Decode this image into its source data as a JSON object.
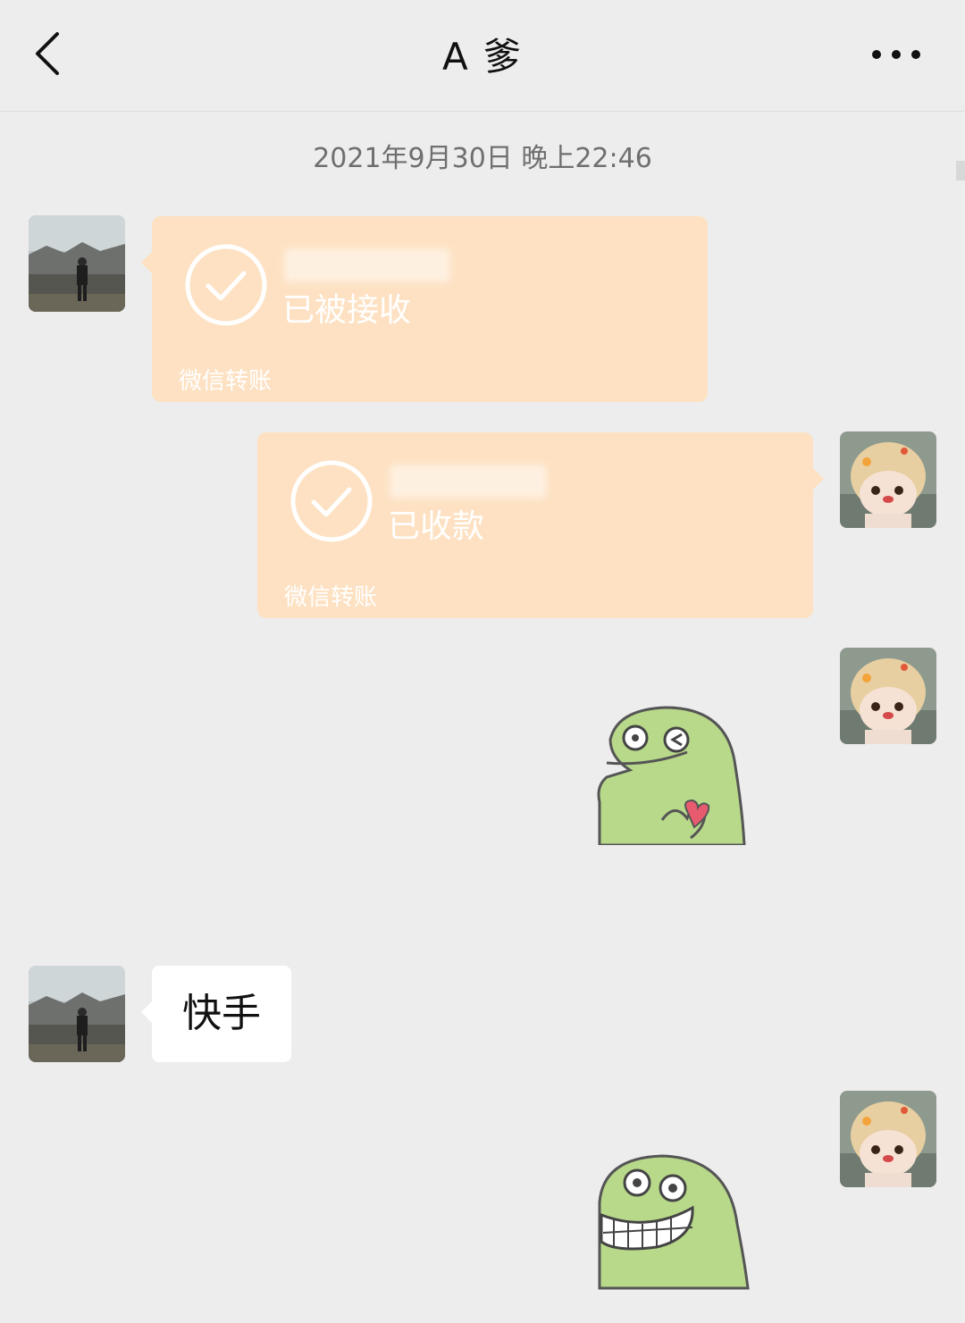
{
  "header": {
    "title": "A 爹",
    "back_icon": "chevron-left-icon",
    "more_icon": "more-dots-icon"
  },
  "chat": {
    "timestamp": "2021年9月30日 晚上22:46",
    "messages": [
      {
        "type": "transfer",
        "sender": "other",
        "status": "已被接收",
        "footer": "微信转账"
      },
      {
        "type": "transfer",
        "sender": "self",
        "status": "已收款",
        "footer": "微信转账"
      },
      {
        "type": "sticker",
        "sender": "self",
        "sticker": "green-dino-heart-sticker"
      },
      {
        "type": "text",
        "sender": "other",
        "text": "快手"
      },
      {
        "type": "sticker",
        "sender": "self",
        "sticker": "green-dino-grin-sticker"
      }
    ]
  },
  "colors": {
    "background": "#ededed",
    "transfer_card": "#fde1c2",
    "bubble_other": "#ffffff",
    "sticker_green": "#a8d37a"
  }
}
